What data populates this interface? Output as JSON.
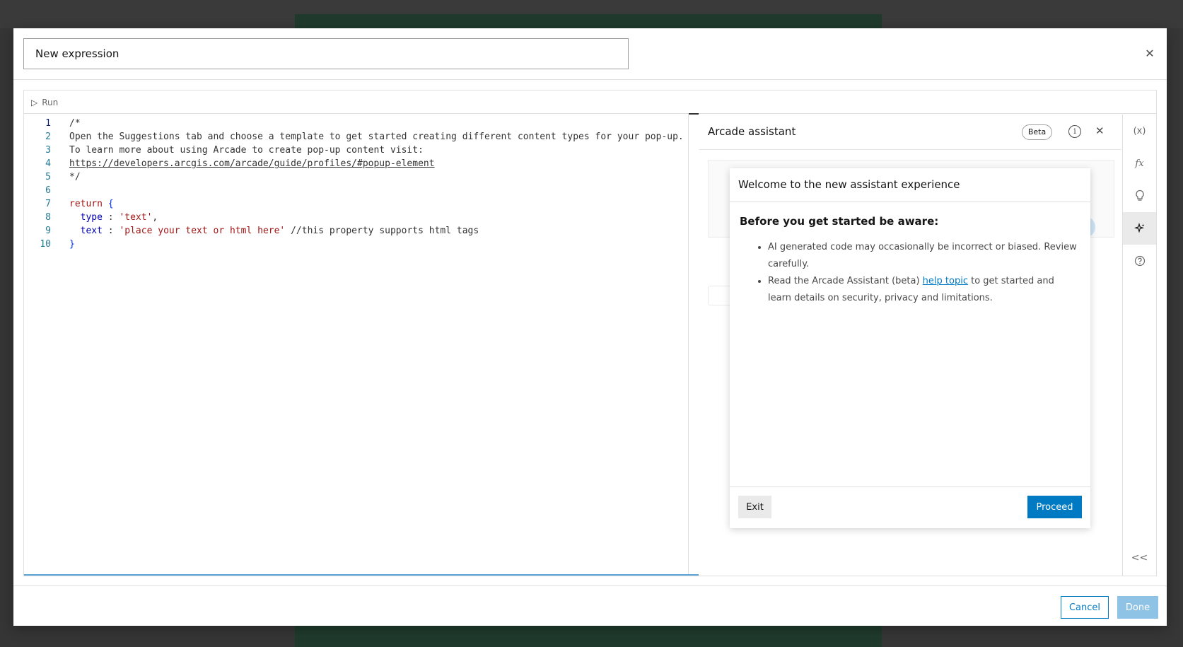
{
  "header": {
    "title_value": "New expression"
  },
  "toolbar": {
    "run_label": "Run"
  },
  "editor": {
    "lines": [
      {
        "n": "1"
      },
      {
        "n": "2"
      },
      {
        "n": "3"
      },
      {
        "n": "4"
      },
      {
        "n": "5"
      },
      {
        "n": "6"
      },
      {
        "n": "7"
      },
      {
        "n": "8"
      },
      {
        "n": "9"
      },
      {
        "n": "10"
      }
    ],
    "l1": "/*",
    "l2": "Open the Suggestions tab and choose a template to get started creating different content types for your pop-up.",
    "l3": "To learn more about using Arcade to create pop-up content visit:",
    "l4": "https://developers.arcgis.com/arcade/guide/profiles/#popup-element",
    "l5": "*/",
    "l7_kw": "return",
    "l7_brace": " {",
    "l8_key": "type",
    "l8_sep": " : ",
    "l8_val": "'text'",
    "l8_end": ",",
    "l9_key": "text",
    "l9_sep": " : ",
    "l9_val": "'place your text or html here'",
    "l9_comment": " //this property supports html tags",
    "l10": "}"
  },
  "assistant": {
    "title": "Arcade assistant",
    "badge": "Beta"
  },
  "welcome": {
    "title": "Welcome to the new assistant experience",
    "subtitle": "Before you get started be aware:",
    "item1": "AI generated code may occasionally be incorrect or biased. Review carefully.",
    "item2_pre": "Read the Arcade Assistant (beta) ",
    "item2_link": "help topic",
    "item2_post": " to get started and learn details on security, privacy and limitations.",
    "exit_label": "Exit",
    "proceed_label": "Proceed"
  },
  "rail": {
    "variables": "(x)",
    "functions": "fx",
    "collapse": "<<"
  },
  "footer": {
    "cancel_label": "Cancel",
    "done_label": "Done"
  },
  "colors": {
    "brand": "#007ac2",
    "done_disabled": "#8fc3e6"
  }
}
